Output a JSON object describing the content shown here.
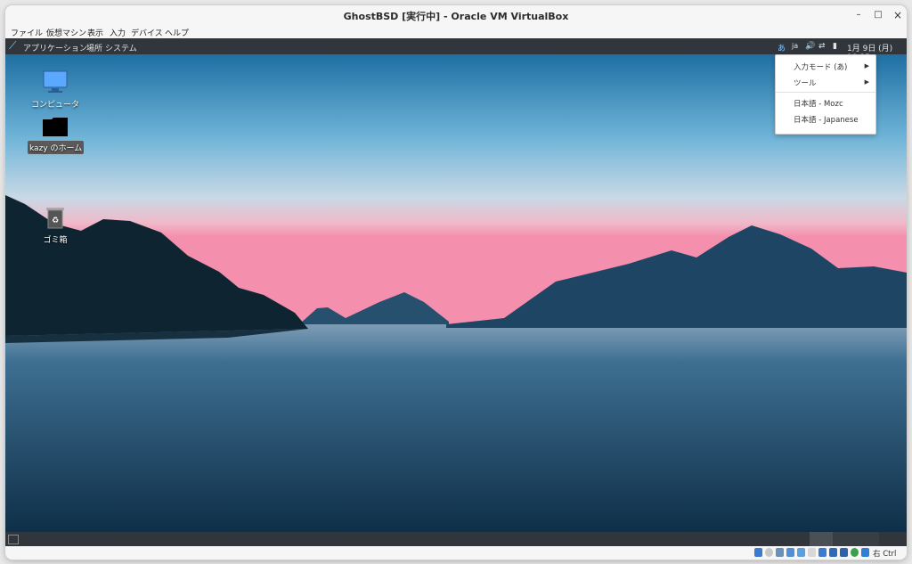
{
  "window": {
    "title": "GhostBSD [実行中] - Oracle VM VirtualBox",
    "controls": [
      "–",
      "□",
      "×"
    ]
  },
  "menubar": [
    "ファイル",
    "仮想マシン",
    "表示",
    "入力",
    "デバイス",
    "ヘルプ"
  ],
  "guest_panel": {
    "menus": [
      "アプリケーション",
      "場所",
      "システム"
    ],
    "tray": {
      "input_mode": "あ",
      "lang": "ja",
      "clock": "1月 9日 (月) 18:35"
    }
  },
  "desktop_icons": [
    {
      "label": "コンピュータ",
      "icon": "computer-icon"
    },
    {
      "label": "kazy のホーム",
      "icon": "home-folder-icon"
    },
    {
      "label": "ゴミ箱",
      "icon": "trash-icon"
    }
  ],
  "ime_menu": {
    "items": [
      "入力モード (あ)",
      "ツール",
      "日本語 - Mozc",
      "日本語 - Japanese"
    ]
  },
  "statusbar": {
    "host_key": "右 Ctrl"
  },
  "colors": {
    "panel": "#30363b",
    "sky_top": "#1e6fa3",
    "horizon_pink": "#f19bb5"
  }
}
